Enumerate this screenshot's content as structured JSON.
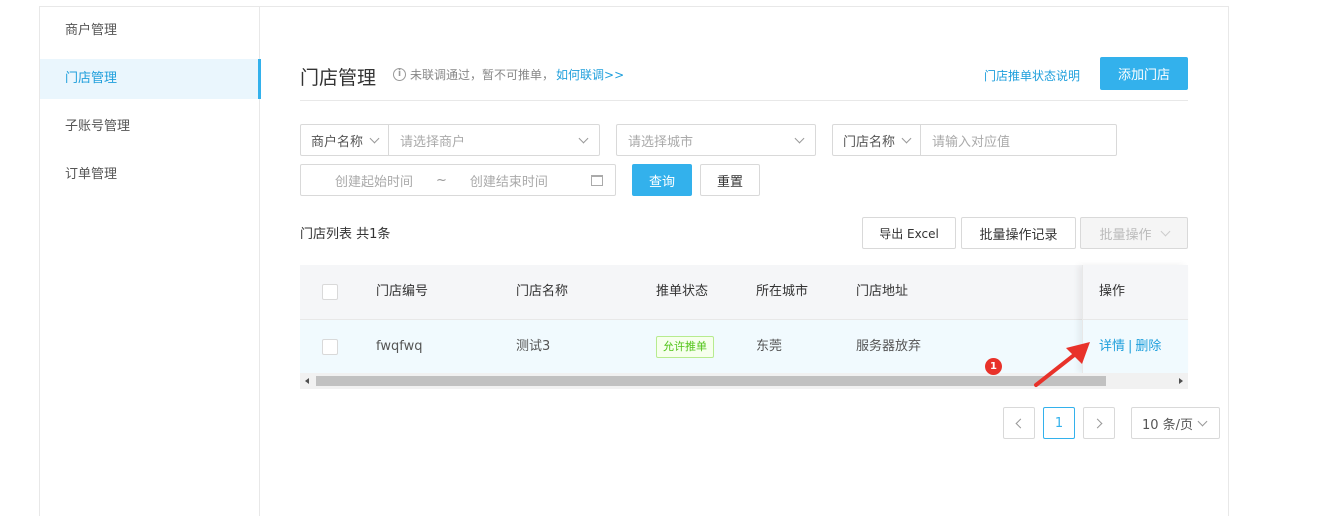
{
  "sidebar": {
    "items": [
      {
        "label": "商户管理",
        "active": false
      },
      {
        "label": "门店管理",
        "active": true
      },
      {
        "label": "子账号管理",
        "active": false
      },
      {
        "label": "订单管理",
        "active": false
      }
    ]
  },
  "header": {
    "title": "门店管理",
    "hint_text": "未联调通过，暂不可推单，",
    "hint_link": "如何联调>>",
    "status_desc_link": "门店推单状态说明",
    "add_button": "添加门店"
  },
  "filters": {
    "merchant_prefix": "商户名称",
    "merchant_placeholder": "请选择商户",
    "city_placeholder": "请选择城市",
    "store_prefix": "门店名称",
    "store_placeholder": "请输入对应值",
    "start_date_placeholder": "创建起始时间",
    "date_separator": "~",
    "end_date_placeholder": "创建结束时间",
    "query_button": "查询",
    "reset_button": "重置"
  },
  "list": {
    "title": "门店列表 共1条",
    "export_button": "导出 Excel",
    "batch_record_button": "批量操作记录",
    "batch_action_button": "批量操作"
  },
  "table": {
    "columns": [
      "门店编号",
      "门店名称",
      "推单状态",
      "所在城市",
      "门店地址",
      "操作"
    ],
    "rows": [
      {
        "store_id": "fwqfwq",
        "store_name": "测试3",
        "push_status": "允许推单",
        "city": "东莞",
        "address": "服务器放弃",
        "action_detail": "详情",
        "action_separator": "|",
        "action_delete": "删除"
      }
    ]
  },
  "pagination": {
    "current_page": "1",
    "page_size": "10 条/页"
  },
  "annotation": {
    "marker": "1"
  },
  "colors": {
    "accent": "#33b1ec",
    "link": "#1f9fdc",
    "success": "#52c41a",
    "marker": "#e8322a"
  }
}
